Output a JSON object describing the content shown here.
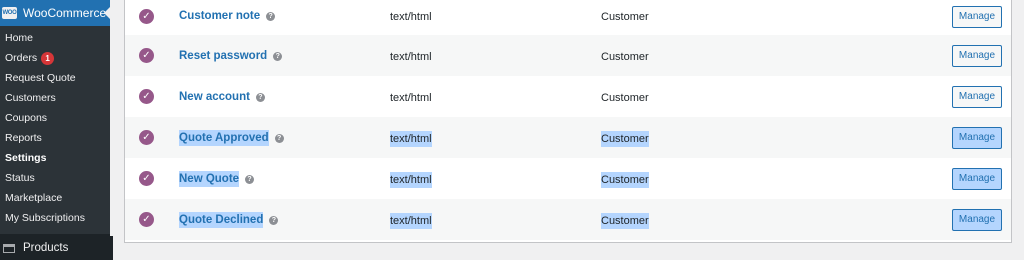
{
  "sidebar": {
    "header_label": "WooCommerce",
    "logo_text": "WOO",
    "items": [
      {
        "label": "Home"
      },
      {
        "label": "Orders",
        "badge": "1"
      },
      {
        "label": "Request Quote"
      },
      {
        "label": "Customers"
      },
      {
        "label": "Coupons"
      },
      {
        "label": "Reports"
      },
      {
        "label": "Settings",
        "active": true
      },
      {
        "label": "Status"
      },
      {
        "label": "Marketplace"
      },
      {
        "label": "My Subscriptions"
      }
    ],
    "products_label": "Products"
  },
  "emails": {
    "help_glyph": "?",
    "check_glyph": "✓",
    "rows": [
      {
        "name": "Customer note",
        "content_type": "text/html",
        "recipient": "Customer",
        "manage_label": "Manage"
      },
      {
        "name": "Reset password",
        "content_type": "text/html",
        "recipient": "Customer",
        "manage_label": "Manage"
      },
      {
        "name": "New account",
        "content_type": "text/html",
        "recipient": "Customer",
        "manage_label": "Manage"
      },
      {
        "name": "Quote Approved",
        "content_type": "text/html",
        "recipient": "Customer",
        "manage_label": "Manage"
      },
      {
        "name": "New Quote",
        "content_type": "text/html",
        "recipient": "Customer",
        "manage_label": "Manage"
      },
      {
        "name": "Quote Declined",
        "content_type": "text/html",
        "recipient": "Customer",
        "manage_label": "Manage"
      }
    ]
  },
  "colors": {
    "sidebar_bg": "#1d2327",
    "accent_blue": "#2271b1",
    "check_purple": "#96588a",
    "badge_red": "#d63638",
    "selection": "#b4d5fe"
  }
}
